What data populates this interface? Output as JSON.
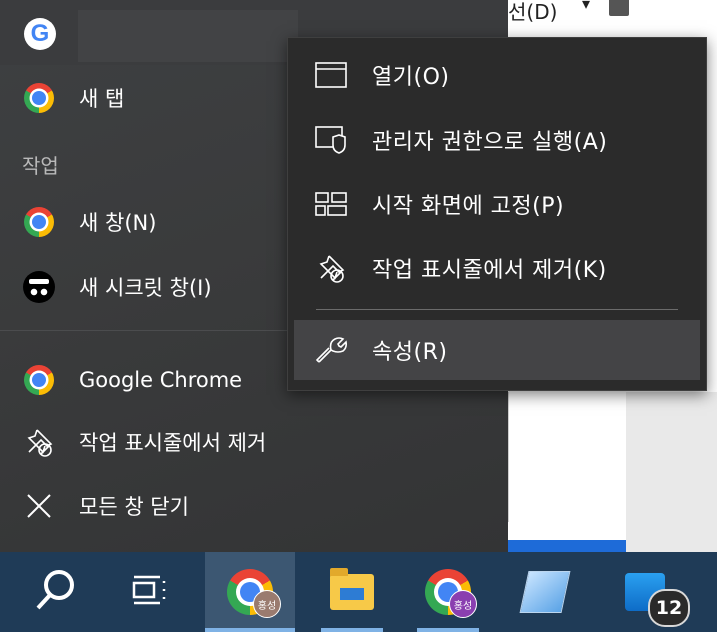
{
  "background_window": {
    "menu_text": "선(D)",
    "dropdown_arrow": "▾"
  },
  "jump_list": {
    "pinned": [
      {
        "label": "새 탭",
        "icon": "chrome-icon"
      }
    ],
    "section_label": "작업",
    "tasks": [
      {
        "label": "새 창(N)",
        "icon": "chrome-icon"
      },
      {
        "label": "새 시크릿 창(I)",
        "icon": "incognito-icon"
      }
    ],
    "app_actions": [
      {
        "label": "Google Chrome",
        "icon": "chrome-icon"
      },
      {
        "label": "작업 표시줄에서 제거",
        "icon": "unpin-icon"
      },
      {
        "label": "모든 창 닫기",
        "icon": "close-icon"
      }
    ]
  },
  "context_menu": {
    "items": [
      {
        "label": "열기(O)",
        "icon": "window-icon"
      },
      {
        "label": "관리자 권한으로 실행(A)",
        "icon": "shield-icon"
      },
      {
        "label": "시작 화면에 고정(P)",
        "icon": "pin-to-start-icon"
      },
      {
        "label": "작업 표시줄에서 제거(K)",
        "icon": "unpin-icon"
      },
      {
        "label": "속성(R)",
        "icon": "wrench-icon"
      }
    ]
  },
  "taskbar": {
    "items": [
      {
        "name": "search",
        "icon": "search-icon"
      },
      {
        "name": "task-view",
        "icon": "task-view-icon"
      },
      {
        "name": "chrome-profile-1",
        "icon": "chrome-icon",
        "badge": "홍성",
        "active": true
      },
      {
        "name": "file-explorer",
        "icon": "folder-icon"
      },
      {
        "name": "chrome-profile-2",
        "icon": "chrome-icon",
        "badge": "홍성"
      },
      {
        "name": "notepad",
        "icon": "notepad-icon"
      },
      {
        "name": "app",
        "icon": "tablet-icon",
        "badge": "12"
      }
    ]
  },
  "colors": {
    "taskbar": "#1f3b57",
    "menu_bg": "#2b2b2b",
    "jumplist_bg": "#3a3b3c",
    "active_underline": "#7fb2e5"
  }
}
